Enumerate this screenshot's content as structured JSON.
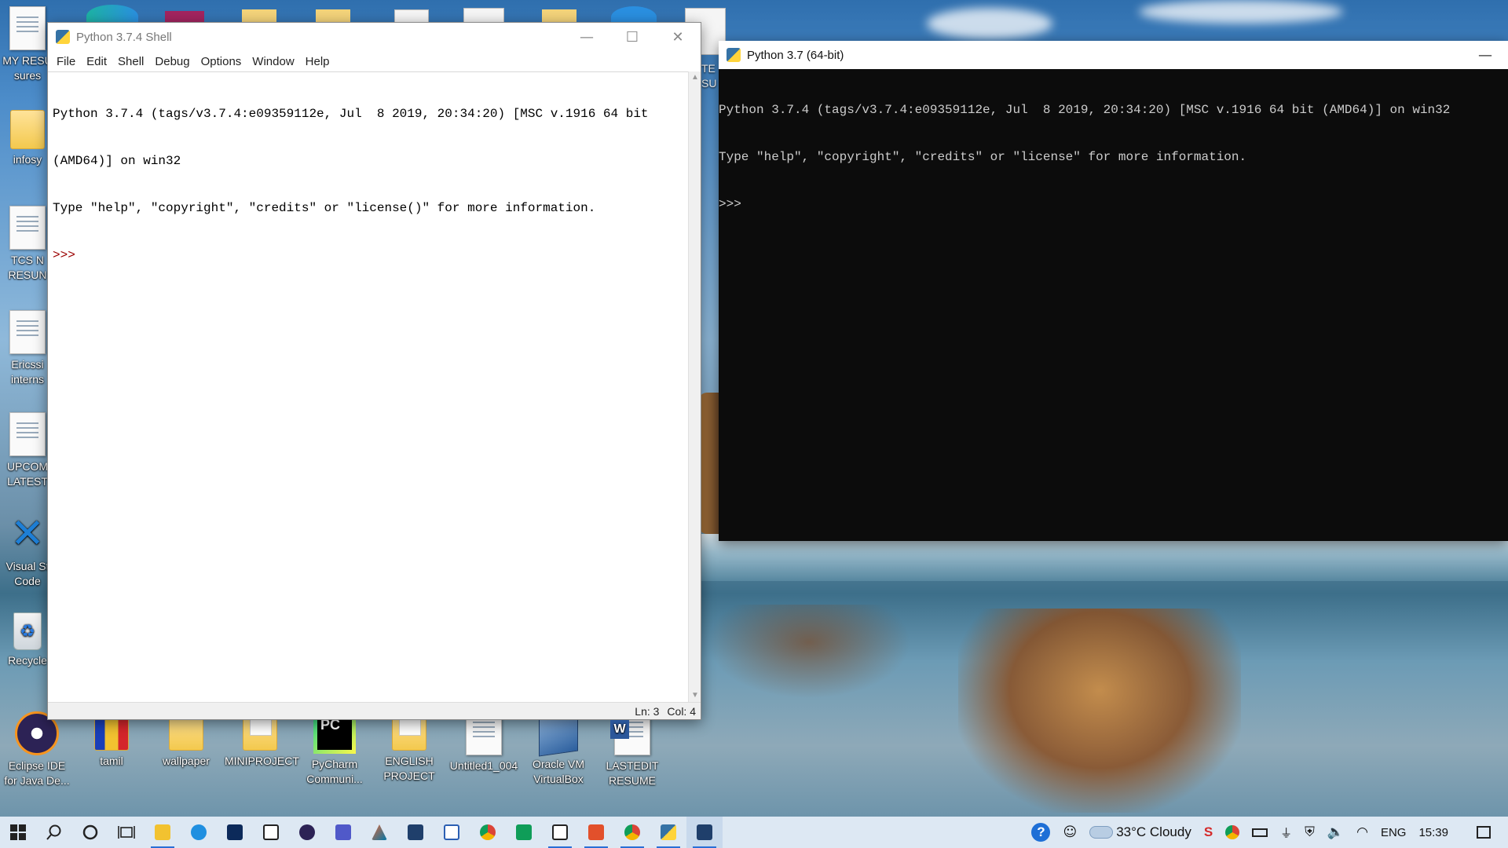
{
  "desktop": {
    "left_column": [
      {
        "label": "MY RESU\nsures",
        "icon": "document-icon"
      },
      {
        "label": "infosy",
        "icon": "folder-icon"
      },
      {
        "label": "TCS N\nRESUN",
        "icon": "document-icon"
      },
      {
        "label": "Ericssi\ninterns",
        "icon": "word-document-icon"
      },
      {
        "label": "UPCOM\nLATEST",
        "icon": "document-icon"
      },
      {
        "label": "Visual St\nCode",
        "icon": "vscode-icon"
      },
      {
        "label": "Recycle",
        "icon": "recycle-bin-icon"
      }
    ],
    "bottom_row": [
      {
        "label": "Eclipse IDE\nfor Java De...",
        "icon": "eclipse-icon"
      },
      {
        "label": "tamil",
        "icon": "folder-icon"
      },
      {
        "label": "wallpaper",
        "icon": "folder-icon"
      },
      {
        "label": "MINIPROJECT",
        "icon": "folder-icon"
      },
      {
        "label": "PyCharm\nCommuni...",
        "icon": "pycharm-icon"
      },
      {
        "label": "ENGLISH\nPROJECT",
        "icon": "folder-icon"
      },
      {
        "label": "Untitled1_004",
        "icon": "document-icon"
      },
      {
        "label": "Oracle VM\nVirtualBox",
        "icon": "virtualbox-icon"
      },
      {
        "label": "LASTEDIT\nRESUME",
        "icon": "word-document-icon"
      }
    ],
    "partial_label": "TE\nSU"
  },
  "idle_window": {
    "title": "Python 3.7.4 Shell",
    "menu": [
      "File",
      "Edit",
      "Shell",
      "Debug",
      "Options",
      "Window",
      "Help"
    ],
    "text_line1": "Python 3.7.4 (tags/v3.7.4:e09359112e, Jul  8 2019, 20:34:20) [MSC v.1916 64 bit",
    "text_line2": "(AMD64)] on win32",
    "text_line3": "Type \"help\", \"copyright\", \"credits\" or \"license()\" for more information.",
    "prompt": ">>> ",
    "status_ln": "Ln: 3",
    "status_col": "Col: 4"
  },
  "console_window": {
    "title": "Python 3.7 (64-bit)",
    "minimize_label": "—",
    "line1": "Python 3.7.4 (tags/v3.7.4:e09359112e, Jul  8 2019, 20:34:20) [MSC v.1916 64 bit (AMD64)] on win32",
    "line2": "Type \"help\", \"copyright\", \"credits\" or \"license\" for more information.",
    "line3": ">>>"
  },
  "taskbar": {
    "weather": "33°C Cloudy",
    "language": "ENG",
    "time": "15:39"
  },
  "colors": {
    "taskbar_bg": "#dde8f3",
    "console_bg": "#0c0c0c",
    "console_fg": "#cccccc",
    "idle_prompt": "#9b0000",
    "active_indicator": "#2a6fd6"
  }
}
